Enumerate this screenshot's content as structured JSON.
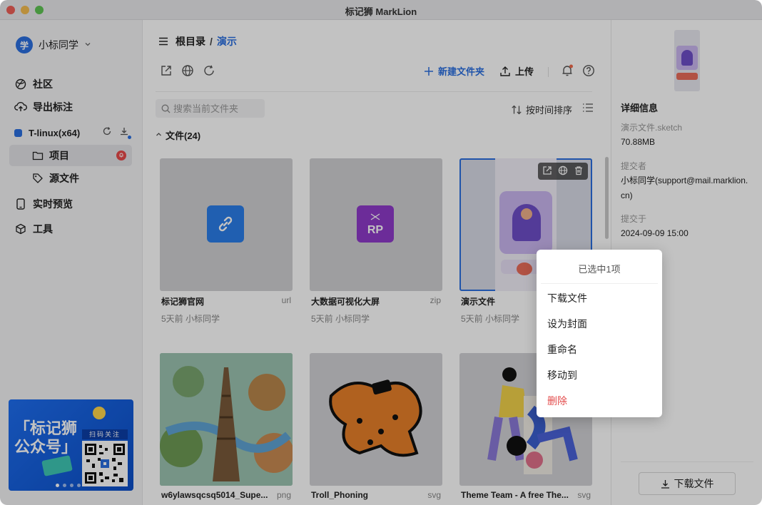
{
  "window": {
    "title": "标记狮 MarkLion"
  },
  "sidebar": {
    "user": {
      "avatar_text": "学",
      "name": "小标同学"
    },
    "nav": [
      {
        "label": "社区",
        "icon": "community-icon"
      },
      {
        "label": "导出标注",
        "icon": "cloud-upload-icon"
      }
    ],
    "team": {
      "name": "T-linux(x64)",
      "color": "#2b6fe0"
    },
    "sub_items": [
      {
        "label": "项目",
        "icon": "folder-icon",
        "active": true
      },
      {
        "label": "源文件",
        "icon": "tag-icon",
        "active": false
      }
    ],
    "nav2": [
      {
        "label": "实时预览",
        "icon": "phone-icon"
      },
      {
        "label": "工具",
        "icon": "cube-icon"
      }
    ],
    "promo": {
      "title": "「标记狮 公众号」",
      "scan_text": "扫码关注"
    }
  },
  "main": {
    "breadcrumb": {
      "root": "根目录",
      "sep": "/",
      "current": "演示"
    },
    "toolbar": {
      "new_folder": "新建文件夹",
      "upload": "上传"
    },
    "search": {
      "placeholder": "搜索当前文件夹"
    },
    "sort": {
      "label": "按时间排序"
    },
    "section": {
      "label": "文件(24)"
    },
    "files": [
      {
        "name": "标记狮官网",
        "ext": "url",
        "meta": "5天前 小标同学"
      },
      {
        "name": "大数据可视化大屏",
        "ext": "zip",
        "meta": "5天前 小标同学"
      },
      {
        "name": "演示文件",
        "ext": "",
        "meta": "5天前 小标同学"
      },
      {
        "name": "w6ylawsqcsq5014_Supe...",
        "ext": "png",
        "meta": ""
      },
      {
        "name": "Troll_Phoning",
        "ext": "svg",
        "meta": ""
      },
      {
        "name": "Theme Team - A free The...",
        "ext": "svg",
        "meta": ""
      }
    ]
  },
  "details": {
    "title": "详细信息",
    "filename": "演示文件.sketch",
    "size": "70.88MB",
    "submitter_label": "提交者",
    "submitter": "小标同学(support@mail.marklion.cn)",
    "submitted_label": "提交于",
    "submitted_at": "2024-09-09 15:00",
    "download_button": "下载文件"
  },
  "context_menu": {
    "title": "已选中1项",
    "items": [
      "下载文件",
      "设为封面",
      "重命名",
      "移动到",
      "删除"
    ]
  },
  "colors": {
    "accent": "#2b6fe0",
    "danger": "#e34b4b"
  }
}
